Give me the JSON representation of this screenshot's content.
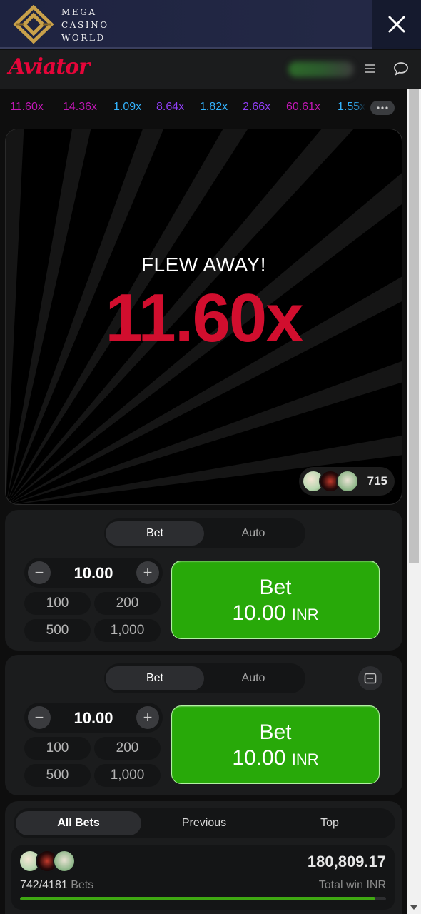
{
  "banner": {
    "brand_line1": "MEGA",
    "brand_line2": "CASINO",
    "brand_line3": "WORLD"
  },
  "header": {
    "logo_text": "Aviator",
    "logo_color": "#e50539"
  },
  "history": [
    {
      "value": "11.60x",
      "color": "#c017b4"
    },
    {
      "value": "14.36x",
      "color": "#c017b4"
    },
    {
      "value": "1.09x",
      "color": "#34b4ff"
    },
    {
      "value": "8.64x",
      "color": "#913ef8"
    },
    {
      "value": "1.82x",
      "color": "#34b4ff"
    },
    {
      "value": "2.66x",
      "color": "#913ef8"
    },
    {
      "value": "60.61x",
      "color": "#c017b4"
    },
    {
      "value": "1.55x",
      "color": "#34b4ff"
    }
  ],
  "game": {
    "status": "FLEW AWAY!",
    "multiplier": "11.60x",
    "players_count": "715"
  },
  "panels": [
    {
      "tab_bet": "Bet",
      "tab_auto": "Auto",
      "amount": "10.00",
      "quick": [
        "100",
        "200",
        "500",
        "1,000"
      ],
      "bet_label": "Bet",
      "bet_amount": "10.00",
      "currency": "INR"
    },
    {
      "tab_bet": "Bet",
      "tab_auto": "Auto",
      "amount": "10.00",
      "quick": [
        "100",
        "200",
        "500",
        "1,000"
      ],
      "bet_label": "Bet",
      "bet_amount": "10.00",
      "currency": "INR"
    }
  ],
  "bets": {
    "tabs": [
      "All Bets",
      "Previous",
      "Top"
    ],
    "count": "742/4181",
    "count_label": "Bets",
    "total_win": "180,809.17",
    "total_win_label": "Total win INR",
    "progress_fraction": 0.97
  }
}
